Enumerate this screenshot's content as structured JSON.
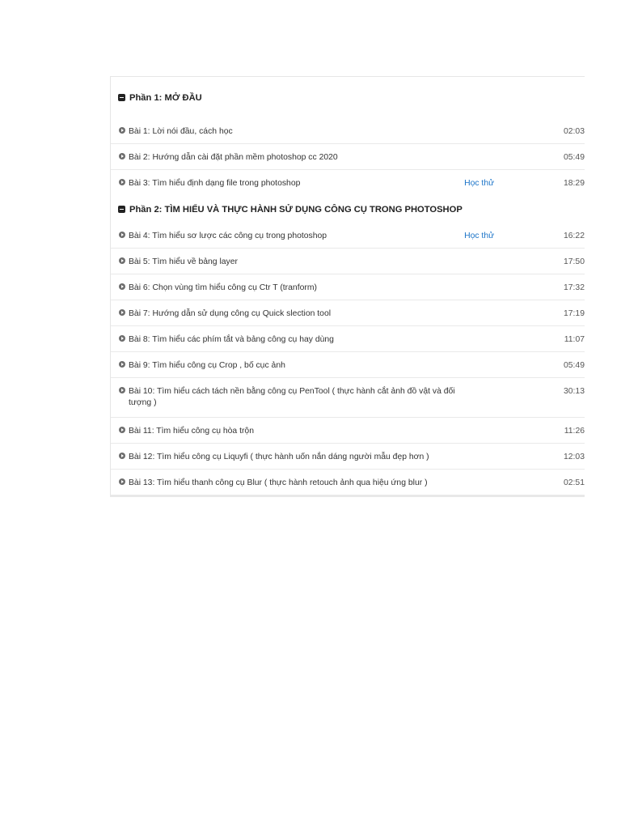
{
  "sections": [
    {
      "title": "Phần 1: MỞ ĐẦU",
      "lessons": [
        {
          "title": "Bài 1: Lời nói đầu, cách học",
          "trial": "",
          "duration": "02:03"
        },
        {
          "title": "Bài 2: Hướng dẫn cài đặt phần mềm photoshop cc 2020",
          "trial": "",
          "duration": "05:49"
        },
        {
          "title": "Bài 3: Tìm hiểu định dạng file trong photoshop",
          "trial": "Học thử",
          "duration": "18:29"
        }
      ]
    },
    {
      "title": "Phần 2: TÌM HIỂU VÀ THỰC HÀNH SỬ DỤNG CÔNG CỤ TRONG PHOTOSHOP",
      "lessons": [
        {
          "title": "Bài 4: Tìm hiểu sơ lược các công cụ trong photoshop",
          "trial": "Học thử",
          "duration": "16:22"
        },
        {
          "title": "Bài 5: Tìm hiểu về bảng layer",
          "trial": "",
          "duration": "17:50"
        },
        {
          "title": "Bài 6: Chọn vùng tìm hiểu công cụ Ctr T (tranform)",
          "trial": "",
          "duration": "17:32"
        },
        {
          "title": "Bài 7: Hướng dẫn sử dụng công cụ Quick slection tool",
          "trial": "",
          "duration": "17:19"
        },
        {
          "title": "Bài 8: Tìm hiểu các phím tắt và bảng công cụ hay dùng",
          "trial": "",
          "duration": "11:07"
        },
        {
          "title": "Bài 9: Tìm hiểu công cụ Crop , bố cục ảnh",
          "trial": "",
          "duration": "05:49"
        },
        {
          "title": "Bài 10: Tìm hiểu cách tách nền bằng công cụ PenTool ( thực hành cắt ảnh đồ vật và đối tượng )",
          "trial": "",
          "duration": "30:13"
        },
        {
          "title": "Bài 11: Tìm hiểu công cụ hòa trộn",
          "trial": "",
          "duration": "11:26"
        },
        {
          "title": "Bài 12: Tìm hiểu công cụ Liquyfi ( thực hành uốn nắn dáng người mẫu đẹp hơn )",
          "trial": "",
          "duration": "12:03"
        },
        {
          "title": "Bài 13: Tìm hiểu thanh công cụ Blur ( thực hành retouch ảnh qua hiệu ứng blur )",
          "trial": "",
          "duration": "02:51"
        }
      ]
    }
  ]
}
